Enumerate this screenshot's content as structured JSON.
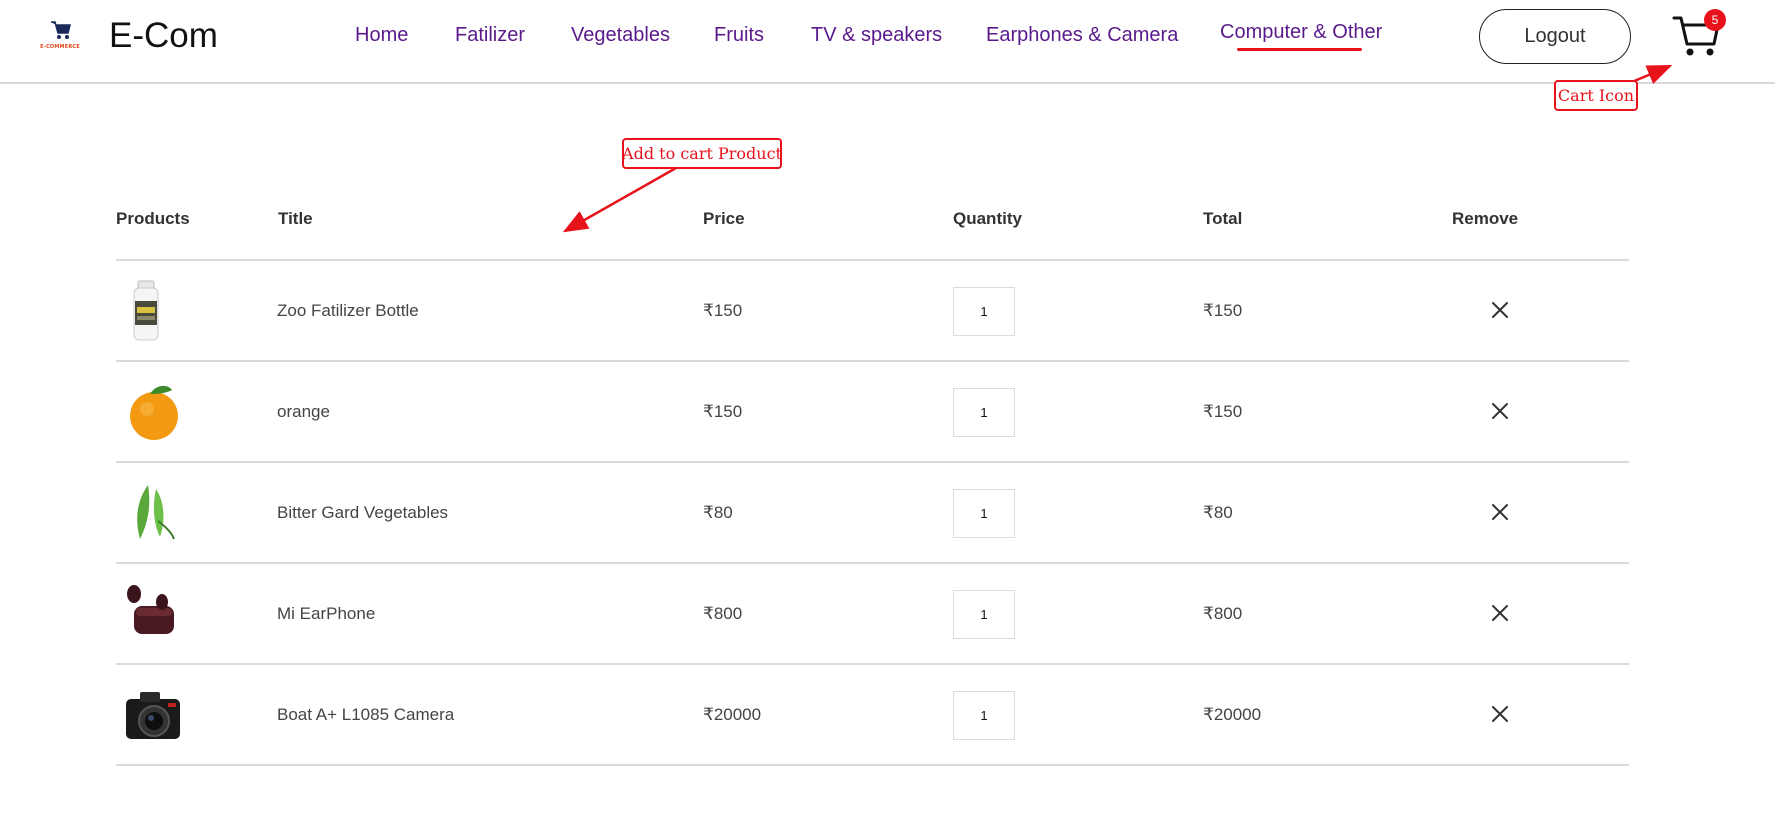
{
  "header": {
    "logo_text": "E-COMMERCE",
    "brand": "E-Com",
    "nav": [
      {
        "label": "Home"
      },
      {
        "label": "Fatilizer"
      },
      {
        "label": "Vegetables"
      },
      {
        "label": "Fruits"
      },
      {
        "label": "TV & speakers"
      },
      {
        "label": "Earphones & Camera"
      },
      {
        "label": "Computer & Other",
        "active": true
      }
    ],
    "logout_label": "Logout",
    "cart_icon": "cart-icon",
    "cart_count": "5"
  },
  "annotations": {
    "add_to_cart": "Add to cart Product",
    "cart_icon": "Cart Icon",
    "color": "#e8121b"
  },
  "table": {
    "headers": [
      "Products",
      "Title",
      "Price",
      "Quantity",
      "Total",
      "Remove"
    ],
    "rows": [
      {
        "image": "fertilizer-bottle-image",
        "title": "Zoo Fatilizer Bottle",
        "price": "₹150",
        "quantity": "1",
        "total": "₹150"
      },
      {
        "image": "orange-image",
        "title": "orange",
        "price": "₹150",
        "quantity": "1",
        "total": "₹150"
      },
      {
        "image": "bitter-gourd-image",
        "title": "Bitter Gard Vegetables",
        "price": "₹80",
        "quantity": "1",
        "total": "₹80"
      },
      {
        "image": "earphone-image",
        "title": "Mi EarPhone",
        "price": "₹800",
        "quantity": "1",
        "total": "₹800"
      },
      {
        "image": "camera-image",
        "title": "Boat A+ L1085 Camera",
        "price": "₹20000",
        "quantity": "1",
        "total": "₹20000"
      }
    ],
    "remove_icon": "close-icon"
  },
  "colors": {
    "nav_text": "#5a1a8c",
    "accent_red": "#e8121b",
    "logo_orange": "#e3481b"
  }
}
